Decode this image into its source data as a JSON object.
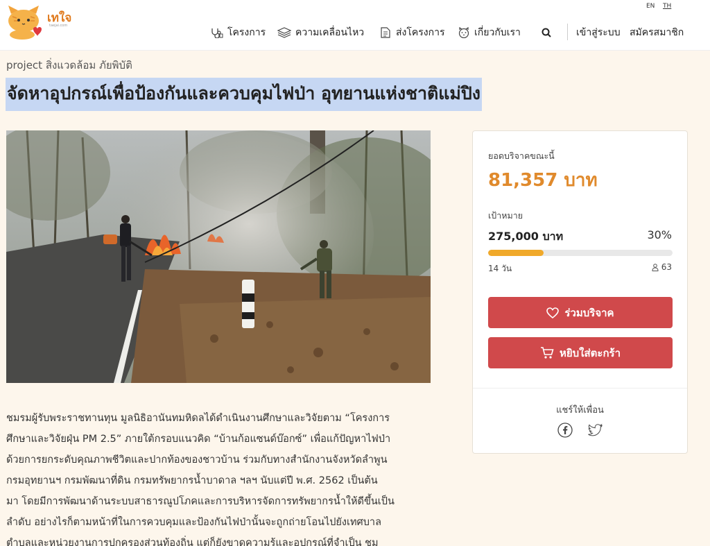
{
  "header": {
    "logo_text": "เทใจ",
    "logo_sub": "taejai.com",
    "lang_en": "EN",
    "lang_th": "TH",
    "nav": {
      "projects": "โครงการ",
      "news": "ความเคลื่อนไหว",
      "submit": "ส่งโครงการ",
      "about": "เกี่ยวกับเรา",
      "login": "เข้าสู่ระบบ",
      "signup": "สมัครสมาชิก"
    }
  },
  "breadcrumb": "project  สิ่งแวดล้อม  ภัยพิบัติ",
  "title": "จัดหาอุปกรณ์เพื่อป้องกันและควบคุมไฟป่า อุทยานแห่งชาติแม่ปิง",
  "body_lines": [
    "ชมรมผู้รับพระราชทานทุน มูลนิธิอานันทมหิดลได้ดำเนินงานศึกษาและวิจัยตาม “โครงการ",
    "ศึกษาและวิจัยฝุ่น PM 2.5” ภายใต้กรอบแนวคิด “บ้านก้อแซนด์บ๊อกซ์” เพื่อแก้ปัญหาไฟป่า",
    "ด้วยการยกระดับคุณภาพชีวิตและปากท้องของชาวบ้าน ร่วมกับทางสำนักงานจังหวัดลำพูน",
    "กรมอุทยานฯ กรมพัฒนาที่ดิน กรมทรัพยากรน้ำบาดาล ฯลฯ นับแต่ปี พ.ศ. 2562 เป็นต้น",
    "มา โดยมีการพัฒนาด้านระบบสาธารณูปโภคและการบริหารจัดการทรัพยากรน้ำให้ดีขึ้นเป็น",
    "ลำดับ อย่างไรก็ตามหน้าที่ในการควบคุมและป้องกันไฟป่านั้นจะถูกถ่ายโอนไปยังเทศบาล",
    "ตำบลและหน่วยงานการปกครองส่วนท้องถิ่น แต่ก็ยังขาดความรู้และอุปกรณ์ที่จำเป็น ชม"
  ],
  "donation": {
    "raised_label": "ยอดบริจาคขณะนี้",
    "raised_amount": "81,357 บาท",
    "goal_label": "เป้าหมาย",
    "goal_amount": "275,000 บาท",
    "percent": "30%",
    "progress_fraction": 0.3,
    "days_left": "14 วัน",
    "backers": "63",
    "donate_button": "ร่วมบริจาค",
    "cart_button": "หยิบใส่ตะกร้า",
    "share_label": "แชร์ให้เพื่อน"
  },
  "colors": {
    "accent_orange": "#e08a2c",
    "button_red": "#d0494b",
    "progress": "#f0a92a",
    "title_highlight": "#c6d7f3",
    "page_bg": "#fdf6ec"
  },
  "icons": {
    "projects": "stethoscope-icon",
    "news": "books-icon",
    "submit": "document-icon",
    "about": "cat-face-icon",
    "search": "search-icon",
    "backers": "person-icon",
    "donate": "heart-icon",
    "cart": "cart-icon",
    "facebook": "facebook-icon",
    "twitter": "twitter-icon"
  }
}
